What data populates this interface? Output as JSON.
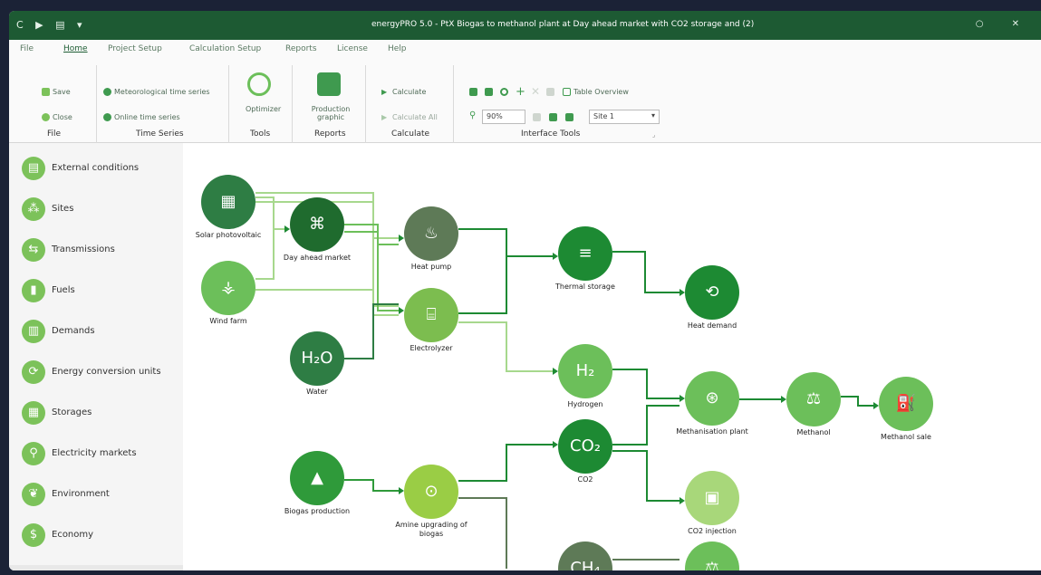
{
  "titlebar": {
    "quick_access": "C ▶ ▤ ▾",
    "title": "energyPRO 5.0 - PtX Biogas to methanol plant at Day ahead market with CO2 storage and (2)",
    "controls": "○ ✕"
  },
  "menu": [
    "File",
    "Home",
    "Project Setup",
    "Calculation Setup",
    "Reports",
    "License",
    "Help"
  ],
  "ribbon": {
    "file": {
      "save": "Save",
      "close": "Close",
      "group": "File"
    },
    "time_series": {
      "meteorological": "Meteorological time series",
      "online": "Online time series",
      "group": "Time Series"
    },
    "tools": {
      "optimizer": "Optimizer",
      "group": "Tools"
    },
    "reports": {
      "production_graphic": "Production graphic",
      "group": "Reports"
    },
    "calculate": {
      "calculate": "Calculate",
      "calculate_all": "Calculate All",
      "group": "Calculate"
    },
    "interface": {
      "zoom_value": "90%",
      "table_overview": "Table Overview",
      "site_value": "Site 1",
      "group": "Interface Tools"
    }
  },
  "sidebar": [
    {
      "label": "External conditions",
      "icon": "chart-icon",
      "glyph": "▤"
    },
    {
      "label": "Sites",
      "icon": "sites-icon",
      "glyph": "⁂"
    },
    {
      "label": "Transmissions",
      "icon": "transmission-icon",
      "glyph": "⇆"
    },
    {
      "label": "Fuels",
      "icon": "fuel-icon",
      "glyph": "▮"
    },
    {
      "label": "Demands",
      "icon": "demand-icon",
      "glyph": "▥"
    },
    {
      "label": "Energy conversion units",
      "icon": "conversion-icon",
      "glyph": "⟳"
    },
    {
      "label": "Storages",
      "icon": "storage-icon",
      "glyph": "▦"
    },
    {
      "label": "Electricity markets",
      "icon": "location-pin-icon",
      "glyph": "⚲"
    },
    {
      "label": "Environment",
      "icon": "leaf-icon",
      "glyph": "❦"
    },
    {
      "label": "Economy",
      "icon": "money-icon",
      "glyph": "$"
    }
  ],
  "nodes": {
    "solar": {
      "label": "Solar photovoltaic",
      "glyph": "▦",
      "color": "#2e7d44"
    },
    "wind": {
      "label": "Wind farm",
      "glyph": "⚶",
      "color": "#6cbf5a"
    },
    "dayahead": {
      "label": "Day ahead market",
      "glyph": "⌘",
      "color": "#1f6b2e"
    },
    "water": {
      "label": "Water",
      "glyph": "H₂O",
      "color": "#2e7d44"
    },
    "heatpump": {
      "label": "Heat pump",
      "glyph": "♨",
      "color": "#5e7a57"
    },
    "electrolyzer": {
      "label": "Electrolyzer",
      "glyph": "⌸",
      "color": "#7cbd4f"
    },
    "thermal": {
      "label": "Thermal storage",
      "glyph": "≡",
      "color": "#1d8a33"
    },
    "heatdemand": {
      "label": "Heat demand",
      "glyph": "⟲",
      "color": "#1d8a33"
    },
    "hydrogen": {
      "label": "Hydrogen",
      "glyph": "H₂",
      "color": "#6cbf5a"
    },
    "co2": {
      "label": "CO2",
      "glyph": "CO₂",
      "color": "#1d8a33"
    },
    "biogas": {
      "label": "Biogas production",
      "glyph": "▲",
      "color": "#2f9a3a"
    },
    "amine": {
      "label": "Amine upgrading of biogas",
      "glyph": "⊙",
      "color": "#9acd45"
    },
    "ch4": {
      "label": "",
      "glyph": "CH₄",
      "color": "#5e7a57"
    },
    "methanation": {
      "label": "Methanisation plant",
      "glyph": "⊛",
      "color": "#6cbf5a"
    },
    "co2inj": {
      "label": "CO2 injection",
      "glyph": "▣",
      "color": "#a8d77a"
    },
    "methanol": {
      "label": "Methanol",
      "glyph": "⚖",
      "color": "#6cbf5a"
    },
    "methanolsale": {
      "label": "Methanol sale",
      "glyph": "⛽",
      "color": "#6cbf5a"
    },
    "bottom": {
      "label": "",
      "glyph": "⚖",
      "color": "#6cbf5a"
    }
  }
}
